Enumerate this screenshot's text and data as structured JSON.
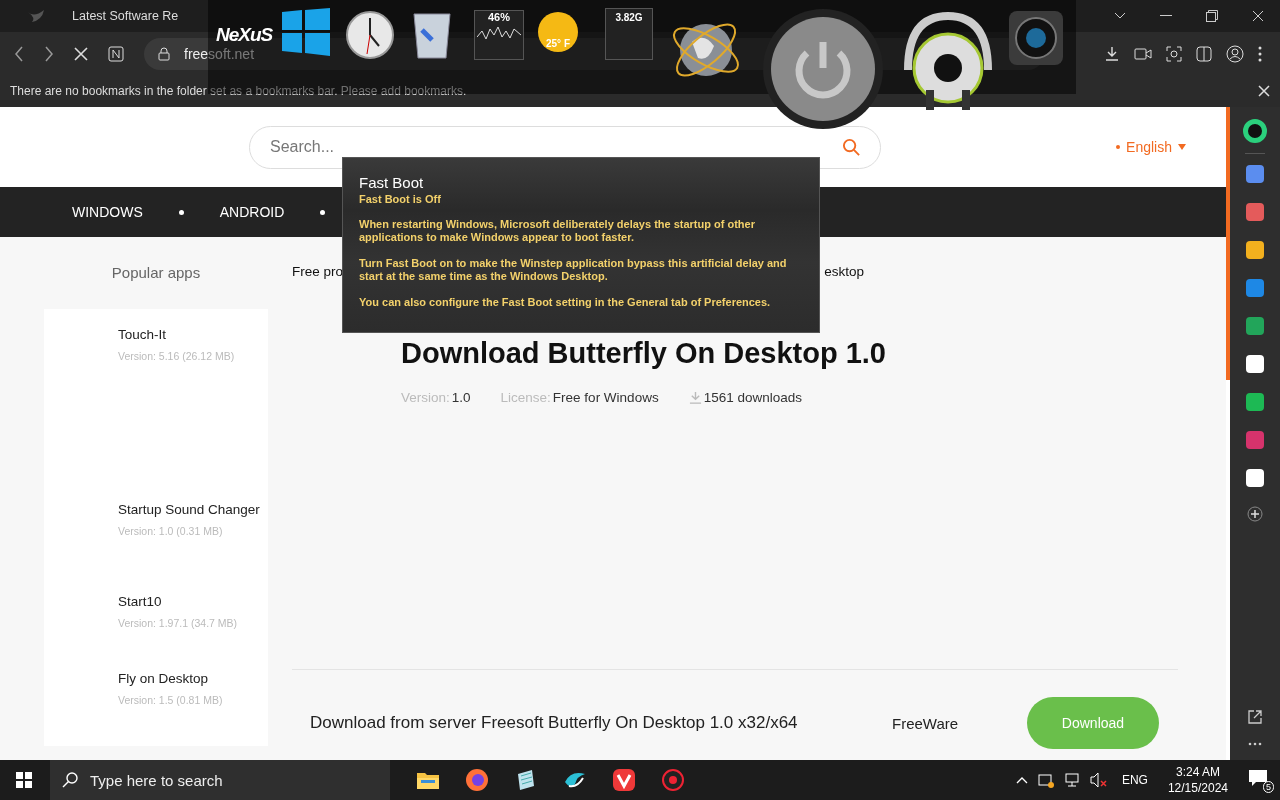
{
  "browser": {
    "tabs": [
      {
        "title": "Latest Software Re"
      }
    ],
    "address": "freesoft.net",
    "bookmarks_message": "There are no bookmarks in the folder set as a bookmarks bar. Please add bookmarks."
  },
  "dock": {
    "logo": "NeXuS",
    "cpu": "46%",
    "weather": "25° F",
    "memory": "3.82G"
  },
  "site": {
    "search_placeholder": "Search...",
    "language": "English",
    "nav": [
      "WINDOWS",
      "ANDROID"
    ]
  },
  "sidebar": {
    "title": "Popular apps",
    "apps": [
      {
        "name": "Touch-It",
        "version": "Version: 5.16 (26.12 MB)"
      },
      {
        "name": "Startup Sound Changer",
        "version": "Version: 1.0 (0.31 MB)"
      },
      {
        "name": "Start10",
        "version": "Version: 1.97.1 (34.7 MB)"
      },
      {
        "name": "Fly on Desktop",
        "version": "Version: 1.5 (0.81 MB)"
      }
    ]
  },
  "breadcrumb": [
    "Free pro",
    "esktop"
  ],
  "program": {
    "title": "Download Butterfly On Desktop 1.0",
    "version_label": "Version:",
    "version": "1.0",
    "license_label": "License:",
    "license": "Free for Windows",
    "downloads": "1561 downloads"
  },
  "download": {
    "server": "Download from server Freesoft Butterfly On Desktop 1.0 x32/x64",
    "type": "FreeWare",
    "button": "Download"
  },
  "tooltip": {
    "title": "Fast Boot",
    "status": "Fast Boot is Off",
    "paragraphs": [
      "When restarting Windows, Microsoft deliberately delays the startup of other applications to make Windows appear to boot faster.",
      "Turn Fast Boot on to make the Winstep application bypass this artificial delay and start at the same time as the Windows Desktop.",
      "You can also configure the Fast Boot setting in the General tab of Preferences."
    ]
  },
  "taskbar": {
    "search_placeholder": "Type here to search",
    "language": "ENG",
    "time": "3:24 AM",
    "date": "12/15/2024",
    "notifications": "5"
  }
}
